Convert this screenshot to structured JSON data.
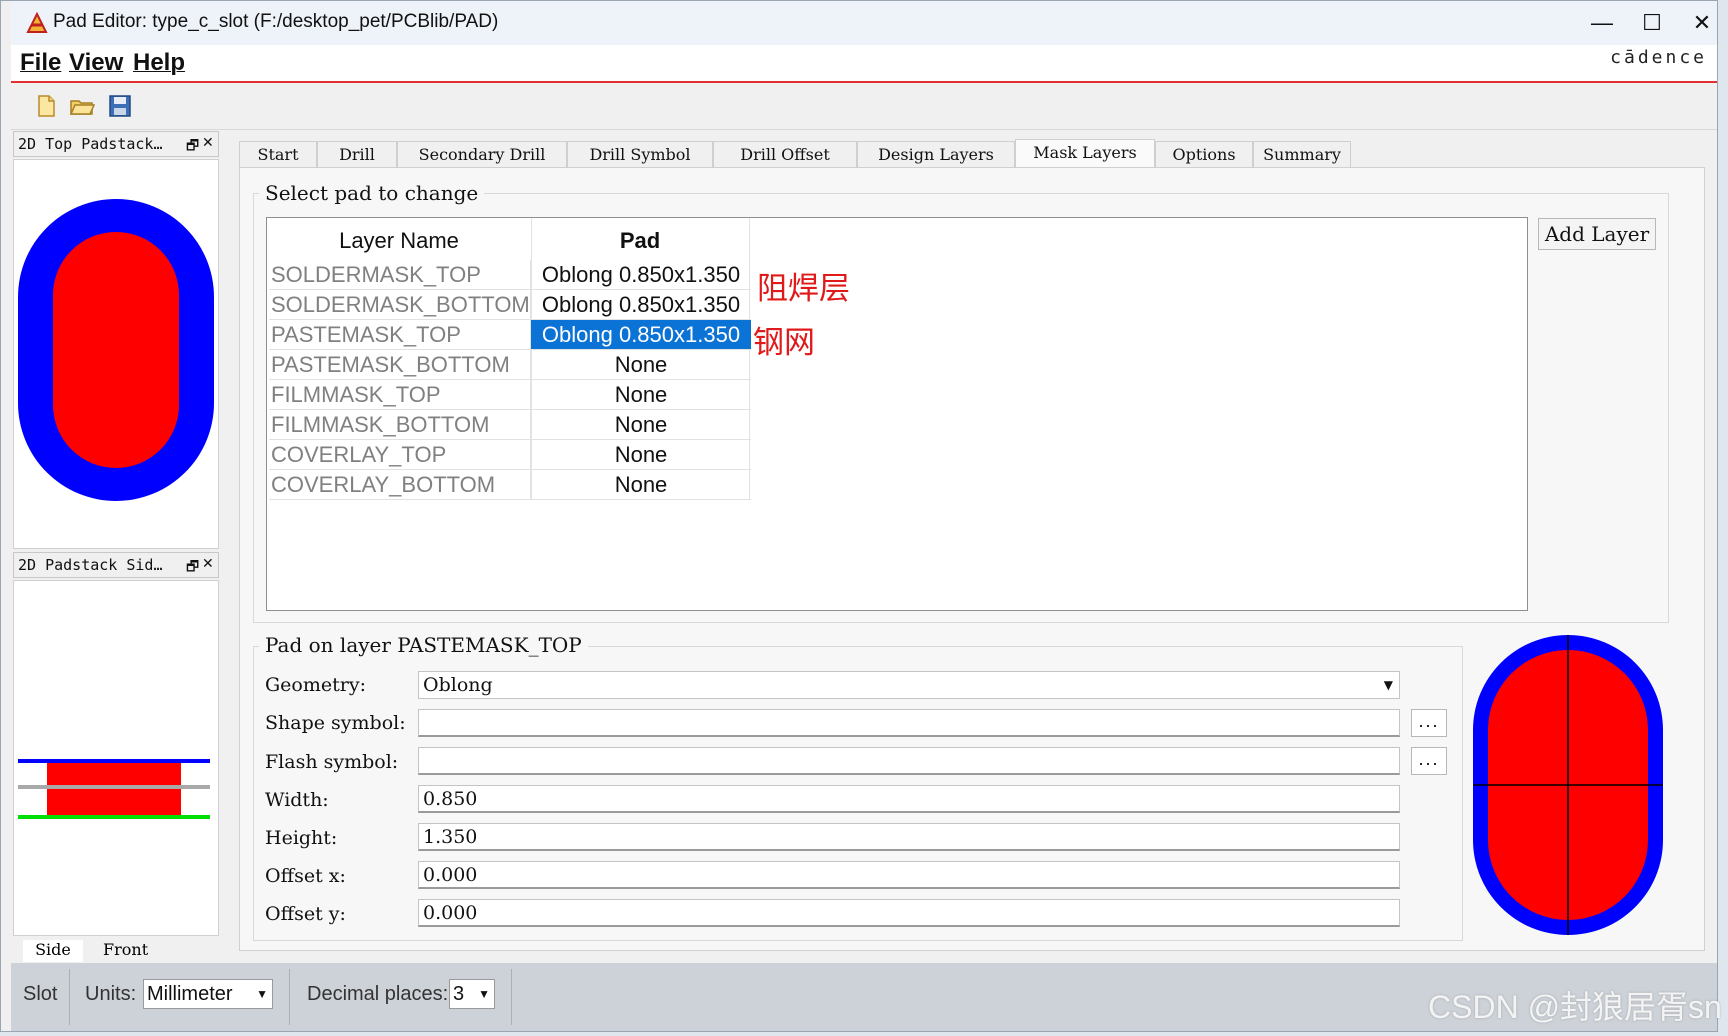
{
  "window": {
    "title": "Pad Editor: type_c_slot  (F:/desktop_pet/PCBlib/PAD)",
    "controls": {
      "minimize": "—",
      "maximize": "☐",
      "close": "✕"
    }
  },
  "menu": {
    "items": [
      "File",
      "View",
      "Help"
    ],
    "brand": "cādence"
  },
  "toolbar": {
    "icons": [
      "new-file-icon",
      "open-folder-icon",
      "save-icon"
    ]
  },
  "docks": {
    "top": {
      "title": "2D Top Padstack…",
      "float": "🗗",
      "close": "✕"
    },
    "side": {
      "title": "2D Padstack Sid…",
      "float": "🗗",
      "close": "✕",
      "tabs": [
        "Side",
        "Front"
      ]
    }
  },
  "tabs": [
    "Start",
    "Drill",
    "Secondary Drill",
    "Drill Symbol",
    "Drill Offset",
    "Design Layers",
    "Mask Layers",
    "Options",
    "Summary"
  ],
  "active_tab": "Mask Layers",
  "select_group": {
    "title": "Select pad to change",
    "headers": {
      "layer": "Layer Name",
      "pad": "Pad"
    },
    "rows": [
      {
        "layer": "SOLDERMASK_TOP",
        "pad": "Oblong 0.850x1.350"
      },
      {
        "layer": "SOLDERMASK_BOTTOM",
        "pad": "Oblong 0.850x1.350"
      },
      {
        "layer": "PASTEMASK_TOP",
        "pad": "Oblong 0.850x1.350"
      },
      {
        "layer": "PASTEMASK_BOTTOM",
        "pad": "None"
      },
      {
        "layer": "FILMMASK_TOP",
        "pad": "None"
      },
      {
        "layer": "FILMMASK_BOTTOM",
        "pad": "None"
      },
      {
        "layer": "COVERLAY_TOP",
        "pad": "None"
      },
      {
        "layer": "COVERLAY_BOTTOM",
        "pad": "None"
      }
    ],
    "selected_row": 2,
    "add_button": "Add Layer",
    "annotations": {
      "soldermask": "阻焊层",
      "pastemask": "钢网"
    }
  },
  "pad_group": {
    "title": "Pad on layer PASTEMASK_TOP",
    "geometry": {
      "label": "Geometry:",
      "value": "Oblong"
    },
    "shape_symbol": {
      "label": "Shape symbol:",
      "value": "",
      "browse": "..."
    },
    "flash_symbol": {
      "label": "Flash symbol:",
      "value": "",
      "browse": "..."
    },
    "width": {
      "label": "Width:",
      "value": "0.850"
    },
    "height": {
      "label": "Height:",
      "value": "1.350"
    },
    "offset_x": {
      "label": "Offset x:",
      "value": "0.000"
    },
    "offset_y": {
      "label": "Offset y:",
      "value": "0.000"
    }
  },
  "status": {
    "slot": "Slot",
    "units_label": "Units:",
    "units_value": "Millimeter",
    "decimal_label": "Decimal places:",
    "decimal_value": "3"
  },
  "watermark": "CSDN @封狼居胥sn",
  "colors": {
    "pad_fill": "#ff0000",
    "mask_ring": "#0000ff",
    "selection": "#0b72d6",
    "accent_line": "#e03030"
  }
}
